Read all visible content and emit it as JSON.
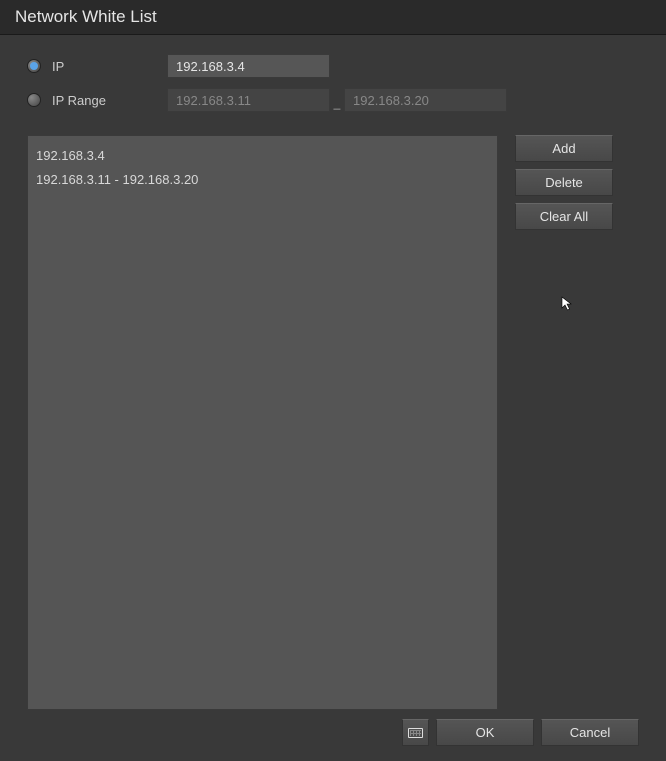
{
  "title": "Network White List",
  "form": {
    "ip_radio_label": "IP",
    "range_radio_label": "IP Range",
    "ip_value": "192.168.3.4",
    "range_start": "192.168.3.11",
    "range_end": "192.168.3.20",
    "selected": "ip"
  },
  "list_items": [
    "192.168.3.4",
    "192.168.3.11 - 192.168.3.20"
  ],
  "buttons": {
    "add": "Add",
    "delete": "Delete",
    "clear_all": "Clear All",
    "ok": "OK",
    "cancel": "Cancel"
  }
}
